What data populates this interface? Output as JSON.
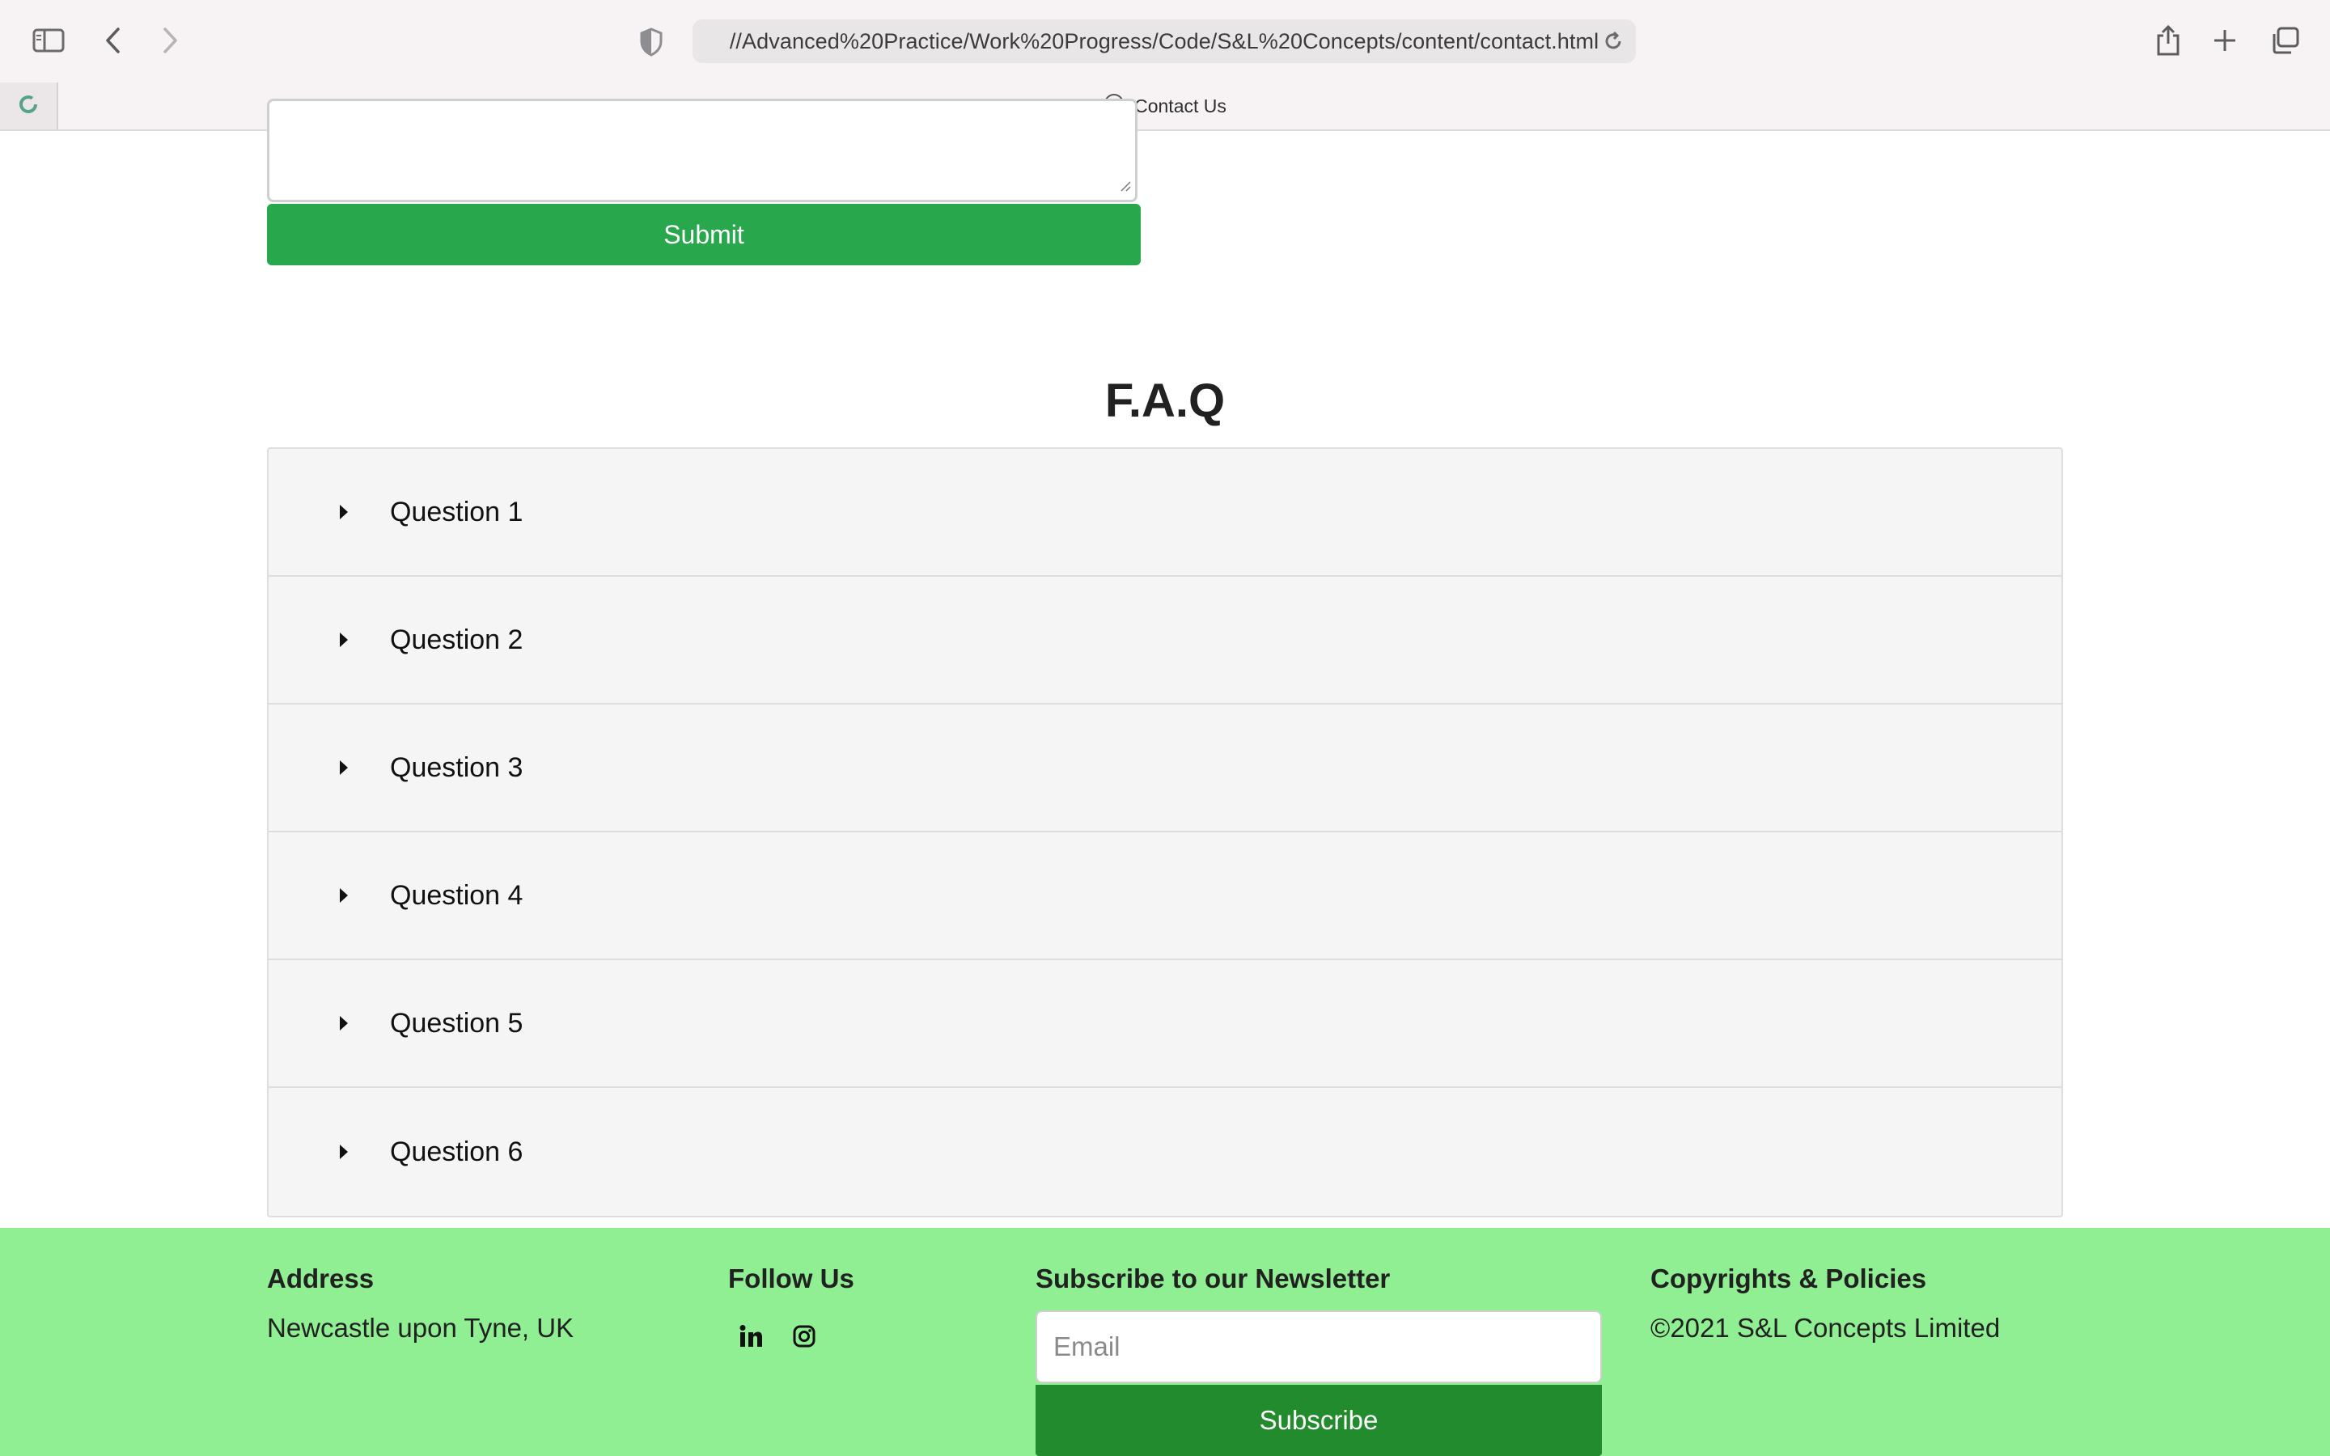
{
  "browser": {
    "url": "//Advanced%20Practice/Work%20Progress/Code/S&L%20Concepts/content/contact.html",
    "tab_title": "Contact Us",
    "icons": [
      "sidebar-icon",
      "back-icon",
      "forward-icon",
      "privacy-shield-icon",
      "reload-icon",
      "share-icon",
      "new-tab-icon",
      "tab-overview-icon",
      "compass-icon"
    ]
  },
  "form": {
    "submit_label": "Submit"
  },
  "faq": {
    "title": "F.A.Q",
    "questions": [
      "Question 1",
      "Question 2",
      "Question 3",
      "Question 4",
      "Question 5",
      "Question 6"
    ]
  },
  "footer": {
    "address_heading": "Address",
    "address_text": "Newcastle upon Tyne, UK",
    "follow_heading": "Follow Us",
    "social_icons": [
      "linkedin-icon",
      "instagram-icon"
    ],
    "newsletter_heading": "Subscribe to our Newsletter",
    "email_placeholder": "Email",
    "subscribe_label": "Subscribe",
    "copyright_heading": "Copyrights & Policies",
    "copyright_text": "©2021 S&L Concepts Limited"
  },
  "colors": {
    "submit_green": "#28a74d",
    "footer_bg": "#90ee93",
    "subscribe_green": "#228b2d",
    "faq_bg": "#f5f5f5"
  }
}
